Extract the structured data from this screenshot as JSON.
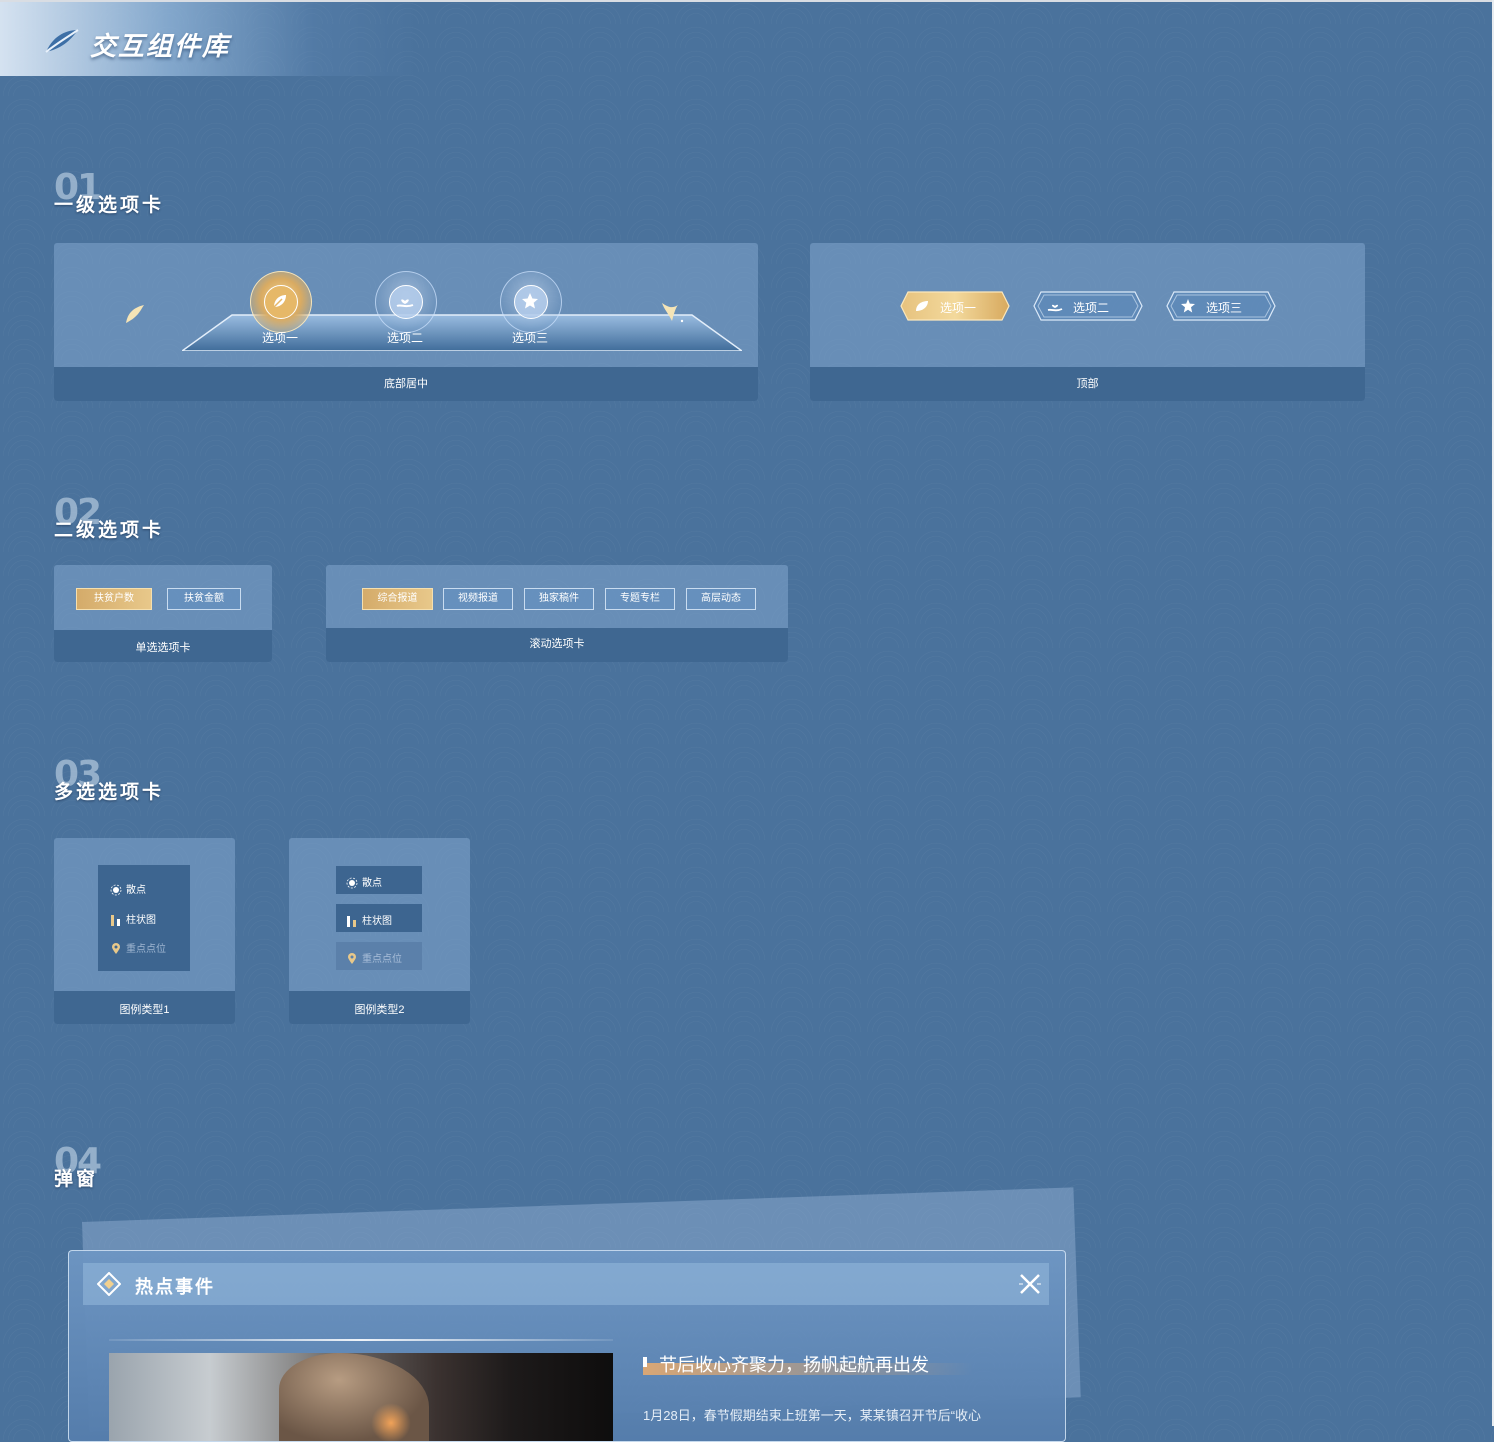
{
  "header": {
    "title": "交互组件库"
  },
  "sections": [
    {
      "num": "01",
      "name": "一级选项卡"
    },
    {
      "num": "02",
      "name": "二级选项卡"
    },
    {
      "num": "03",
      "name": "多选选项卡"
    },
    {
      "num": "04",
      "name": "弹窗"
    }
  ],
  "level1": {
    "bottom_center": {
      "tabs": [
        {
          "label": "选项一",
          "icon": "leaf-icon",
          "active": true
        },
        {
          "label": "选项二",
          "icon": "hand-heart-icon",
          "active": false
        },
        {
          "label": "选项三",
          "icon": "star-icon",
          "active": false
        }
      ],
      "caption": "底部居中"
    },
    "top": {
      "tabs": [
        {
          "label": "选项一",
          "icon": "leaf-icon",
          "active": true
        },
        {
          "label": "选项二",
          "icon": "hand-heart-icon",
          "active": false
        },
        {
          "label": "选项三",
          "icon": "star-icon",
          "active": false
        }
      ],
      "caption": "顶部"
    }
  },
  "level2": {
    "single": {
      "tabs": [
        {
          "label": "扶贫户数",
          "active": true
        },
        {
          "label": "扶贫金额",
          "active": false
        }
      ],
      "caption": "单选选项卡"
    },
    "scroll": {
      "tabs": [
        {
          "label": "综合报道",
          "active": true
        },
        {
          "label": "视频报道",
          "active": false
        },
        {
          "label": "独家稿件",
          "active": false
        },
        {
          "label": "专题专栏",
          "active": false
        },
        {
          "label": "高层动态",
          "active": false
        }
      ],
      "caption": "滚动选项卡"
    }
  },
  "multi": {
    "legend1": {
      "items": [
        {
          "label": "散点",
          "icon": "scatter-icon",
          "active": true
        },
        {
          "label": "柱状图",
          "icon": "bar-chart-icon",
          "active": true
        },
        {
          "label": "重点点位",
          "icon": "location-pin-icon",
          "active": false
        }
      ],
      "caption": "图例类型1"
    },
    "legend2": {
      "items": [
        {
          "label": "散点",
          "icon": "scatter-icon",
          "active": true
        },
        {
          "label": "柱状图",
          "icon": "bar-chart-icon",
          "active": true
        },
        {
          "label": "重点点位",
          "icon": "location-pin-icon",
          "active": false
        }
      ],
      "caption": "图例类型2"
    }
  },
  "popup": {
    "title": "热点事件",
    "news_title": "节后收心齐聚力，扬帆起航再出发",
    "news_text": "1月28日，春节假期结束上班第一天，某某镇召开节后“收心"
  },
  "colors": {
    "background": "#4a729c",
    "accent_gold": "#d9ab62",
    "footer": "#3f6791"
  }
}
